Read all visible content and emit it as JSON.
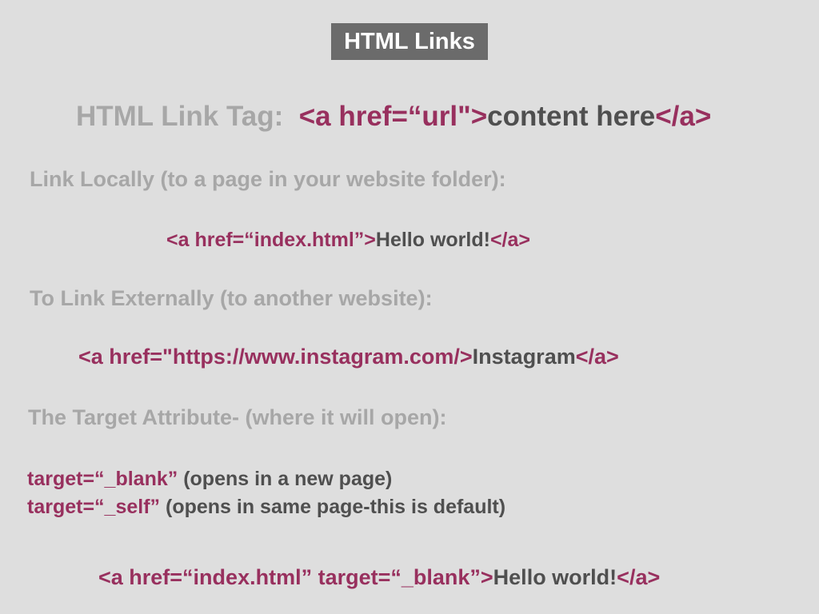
{
  "slide": {
    "title": "HTML Links",
    "link_tag": {
      "label": "HTML Link Tag:",
      "open_tag": "<a href=“url\">",
      "content": "content here",
      "close_tag": "</a>"
    },
    "local_heading": "Link Locally (to a page in your website folder):",
    "local_example": {
      "open_tag": "<a href=“index.html”>",
      "content": "Hello world!",
      "close_tag": "</a>"
    },
    "external_heading": "To Link Externally (to another website):",
    "external_example": {
      "open_tag": "<a href=\"https://www.instagram.com/>",
      "content": "Instagram",
      "close_tag": "</a>"
    },
    "target_heading": "The Target Attribute- (where it will open):",
    "target_blank": {
      "code": "target=“_blank”",
      "desc": " (opens in a new page)"
    },
    "target_self": {
      "code": "target=“_self”",
      "desc": " (opens in same page-this is default)"
    },
    "target_example": {
      "open_tag": "<a href=“index.html” target=“_blank”>",
      "content": "Hello world!",
      "close_tag": "</a>"
    },
    "colors": {
      "background": "#dedede",
      "title_box": "#6b6b6b",
      "code": "#98305e",
      "content_text": "#4f4f4f",
      "heading_gray": "#a7a7a7"
    }
  }
}
